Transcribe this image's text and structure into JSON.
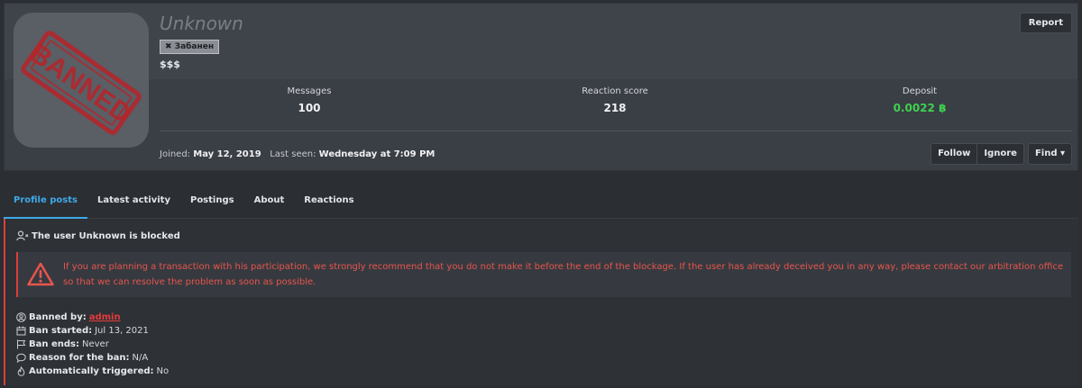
{
  "profile": {
    "username": "Unknown",
    "badge": "✖ Забанен",
    "user_title": "$$$",
    "report_label": "Report",
    "avatar_stamp": "BANNED"
  },
  "stats": [
    {
      "label": "Messages",
      "value": "100"
    },
    {
      "label": "Reaction score",
      "value": "218"
    },
    {
      "label": "Deposit",
      "value": "0.0022 ฿"
    }
  ],
  "joined": {
    "joined_label": "Joined:",
    "joined_value": "May 12, 2019",
    "last_seen_label": "Last seen:",
    "last_seen_value": "Wednesday at 7:09 PM"
  },
  "actions": {
    "follow": "Follow",
    "ignore": "Ignore",
    "find": "Find ▾"
  },
  "tabs": [
    {
      "label": "Profile posts",
      "active": true
    },
    {
      "label": "Latest activity"
    },
    {
      "label": "Postings"
    },
    {
      "label": "About"
    },
    {
      "label": "Reactions"
    }
  ],
  "blocked": {
    "title": "The user Unknown is blocked",
    "warning": "If you are planning a transaction with his participation, we strongly recommend that you do not make it before the end of the blockage. If the user has already deceived you in any way, please contact our arbitration office so that we can resolve the problem as soon as possible."
  },
  "ban_info": {
    "banned_by_label": "Banned by:",
    "banned_by_value": "admin",
    "started_label": "Ban started:",
    "started_value": "Jul 13, 2021",
    "ends_label": "Ban ends:",
    "ends_value": "Never",
    "reason_label": "Reason for the ban:",
    "reason_value": "N/A",
    "auto_label": "Automatically triggered:",
    "auto_value": "No"
  },
  "colors": {
    "accent": "#3fa9e8",
    "danger": "#d8413b",
    "deposit": "#3fd14f"
  }
}
